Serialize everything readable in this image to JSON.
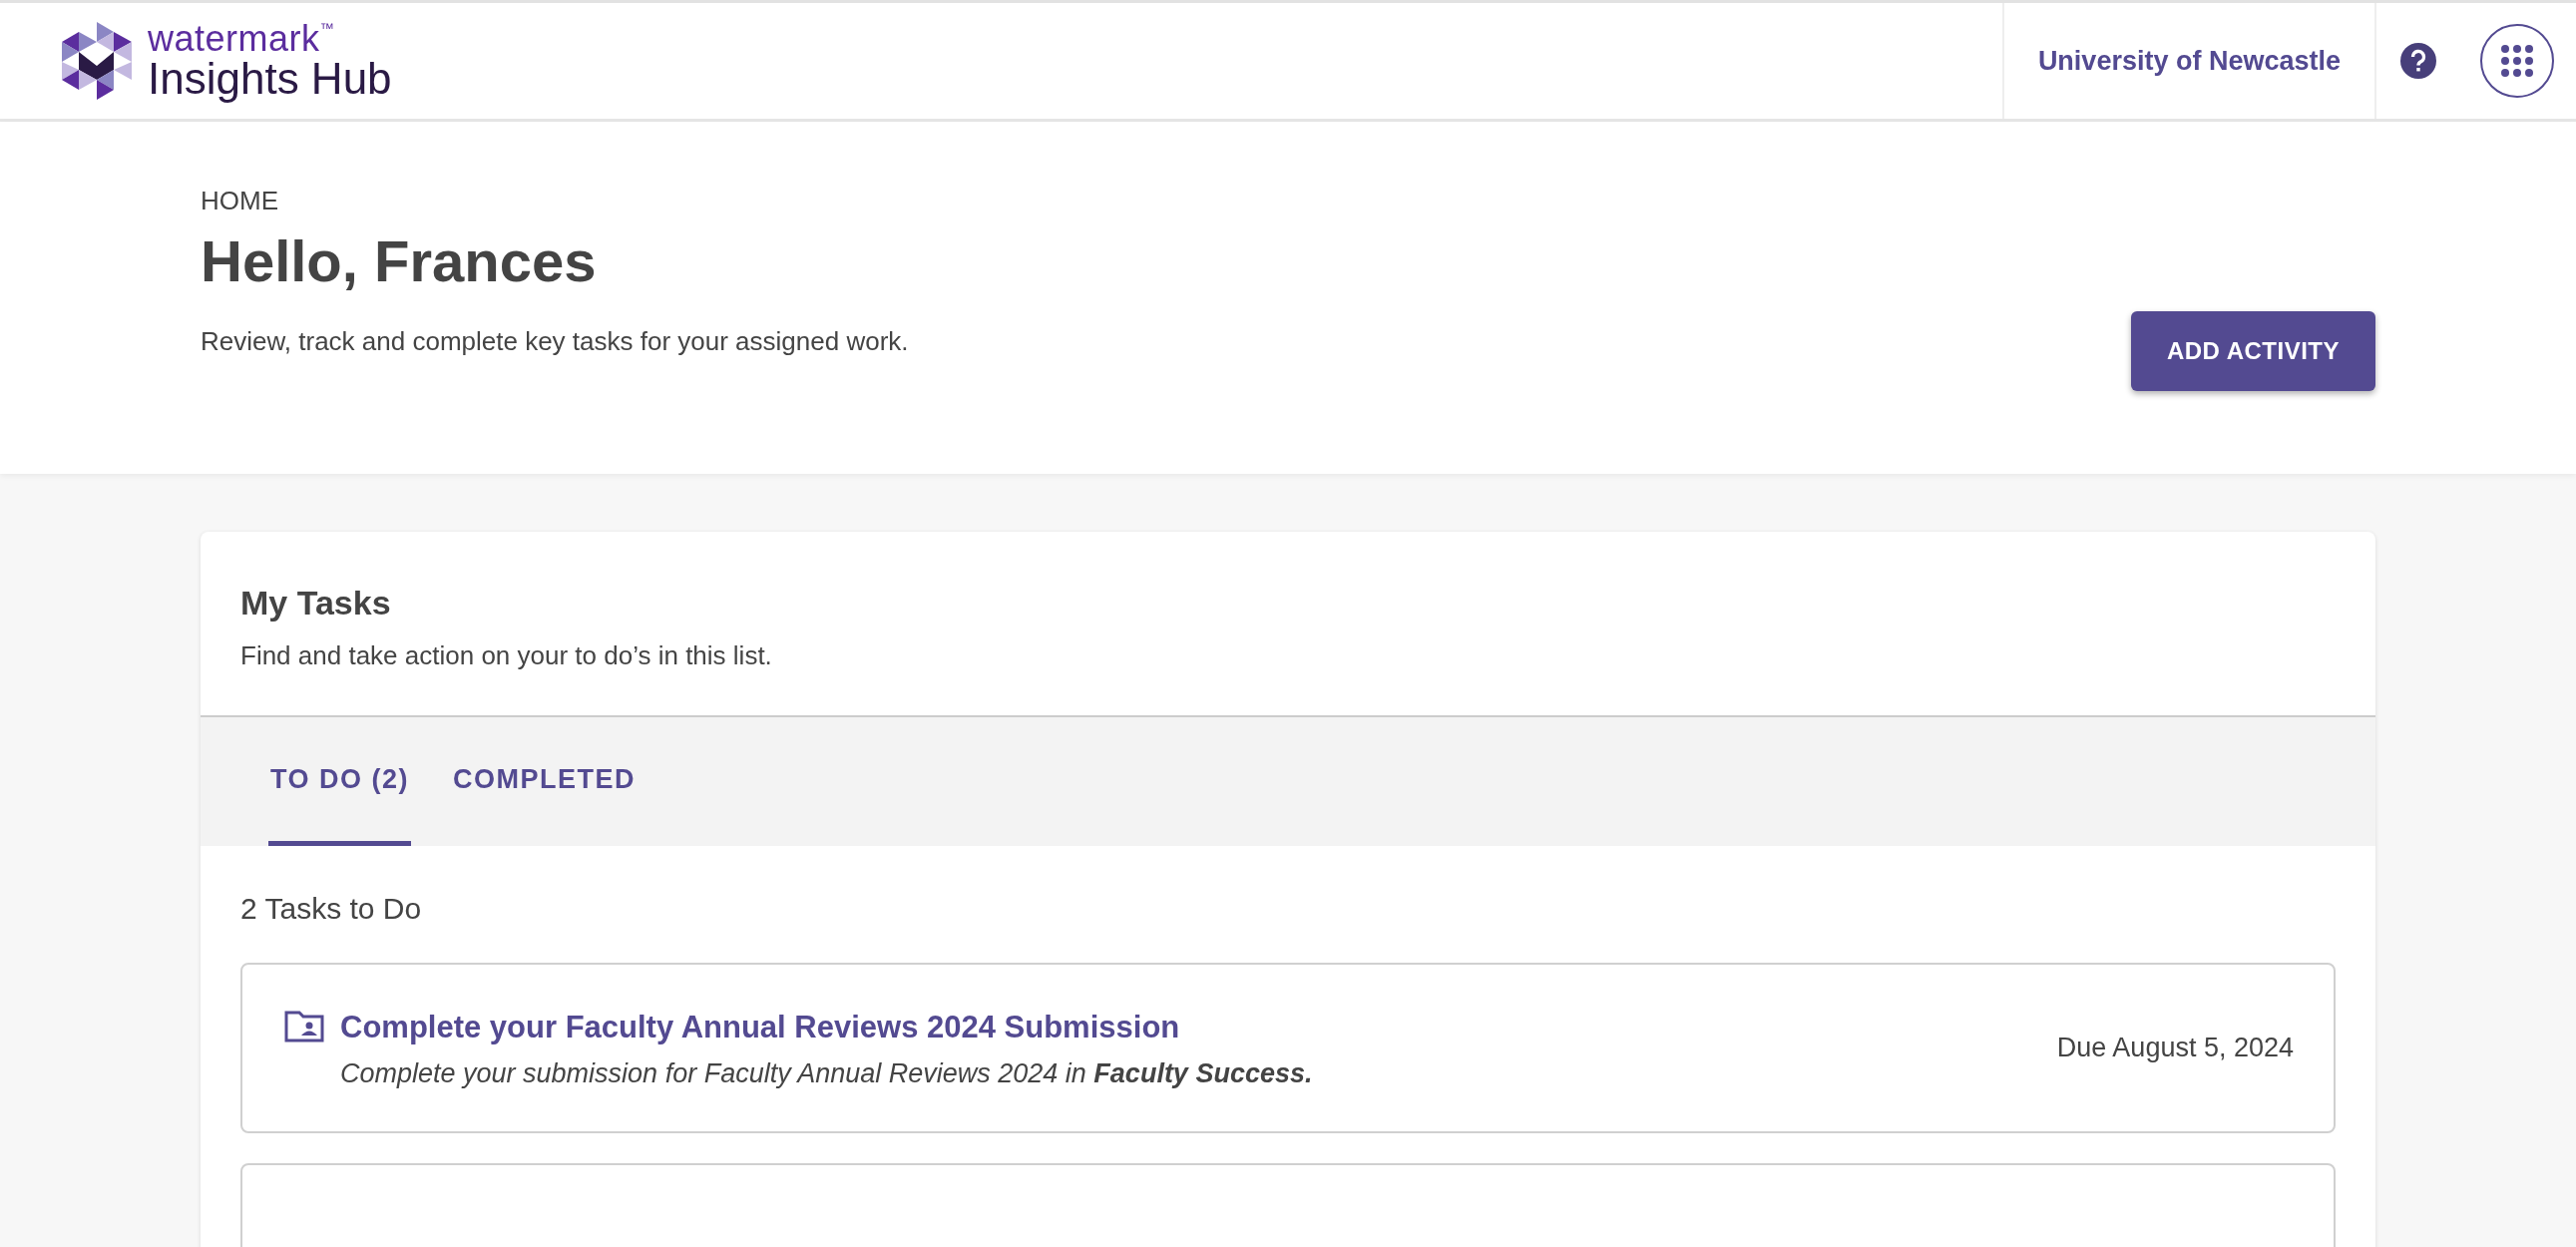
{
  "header": {
    "logo": {
      "brand": "watermark",
      "trademark": "™",
      "product": "Insights Hub"
    },
    "institution": "University of Newcastle"
  },
  "page": {
    "breadcrumb": "HOME",
    "title": "Hello, Frances",
    "subtitle": "Review, track and complete key tasks for your assigned work.",
    "action_button": "ADD ACTIVITY"
  },
  "tasks_panel": {
    "title": "My Tasks",
    "subtitle": "Find and take action on your to do’s in this list.",
    "tabs": [
      {
        "label": "TO DO (2)",
        "selected": true
      },
      {
        "label": "COMPLETED",
        "selected": false
      }
    ],
    "count_label": "2 Tasks to Do",
    "tasks": [
      {
        "title": "Complete your Faculty Annual Reviews 2024 Submission",
        "description": "Complete your submission for Faculty Annual Reviews 2024 in **Faculty Success.**",
        "due": "Due August 5, 2024"
      }
    ]
  }
}
